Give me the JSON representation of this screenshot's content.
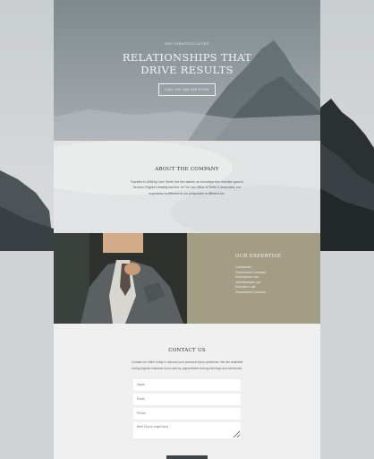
{
  "hero": {
    "brand": "SMITH&ASSOCIATES",
    "title_line1": "RELATIONSHIPS THAT",
    "title_line2": "DRIVE RESULTS",
    "cta_label": "CALL US: 555 456 87245"
  },
  "about": {
    "title": "ABOUT THE COMPANY",
    "text": "Founded in 1896 by John Smith, the firm started as a boutique firm that later grew to become Virginia's leading law firm. At The Law Office of Smith & Associates, our experience is different so our perspective is different too."
  },
  "expertise": {
    "title": "OUR EXPERTISE",
    "items": [
      "Contractual",
      "Government Contracts",
      "Employment Law",
      "Administrative Law",
      "Education Law",
      "Government Contracts"
    ]
  },
  "contact": {
    "title": "CONTACT US",
    "text": "Contact our office today to discuss your personal injury questions. We are available during regular business hours and by appointment during evenings and weekends.",
    "fields": {
      "name_placeholder": "Name",
      "email_placeholder": "Email",
      "phone_placeholder": "Phone",
      "issue_placeholder": "Brief of your legal issue"
    }
  },
  "colors": {
    "hero_overlay": "#7b868b",
    "about_bg": "#e3e4e5",
    "expertise_bg": "#a39d86",
    "contact_bg": "#efefef",
    "button_dark": "#3d4548"
  }
}
